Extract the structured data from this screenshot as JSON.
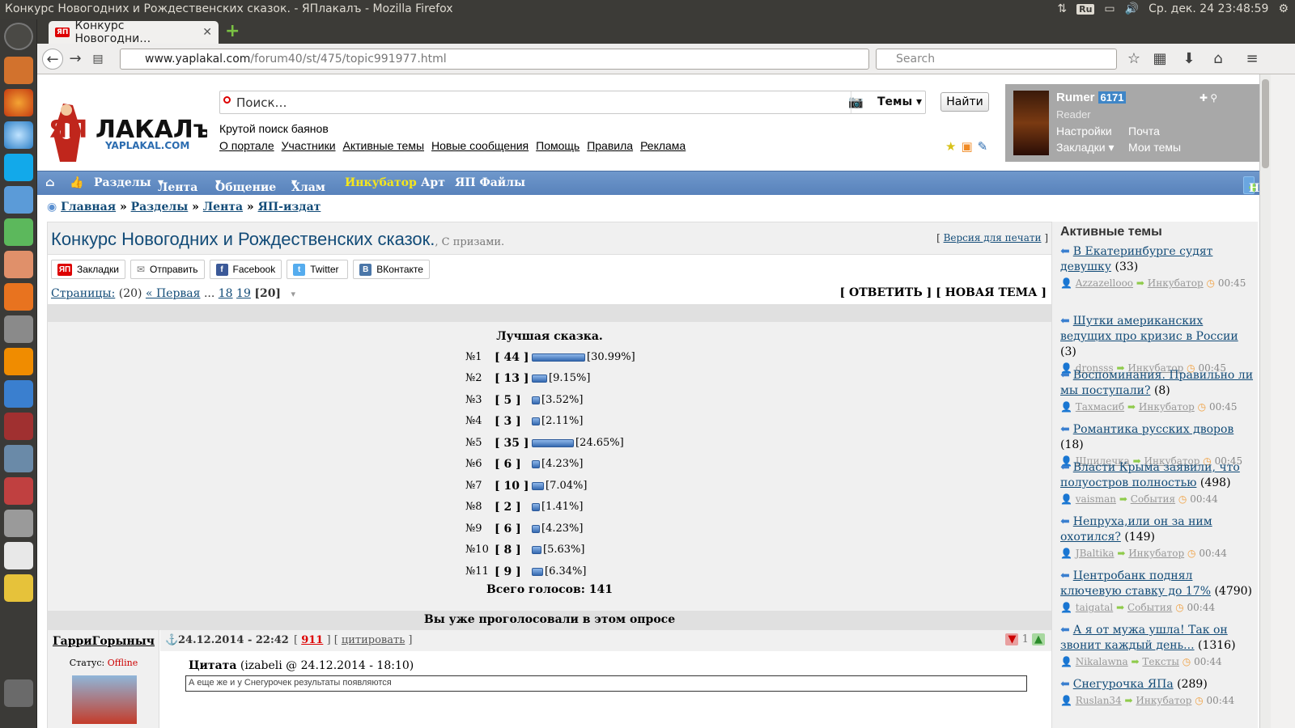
{
  "os": {
    "window_title": "Конкурс Новогодних и Рождественских сказок. - ЯПлакалъ - Mozilla Firefox",
    "lang": "Ru",
    "clock": "Ср. дек. 24 23:48:59"
  },
  "browser": {
    "tab_title": "Конкурс Новогодни…",
    "tab_favicon": "ЯП",
    "url_host": "www.yaplakal.com",
    "url_path": "/forum40/st/475/topic991977.html",
    "search_placeholder": "Search"
  },
  "site": {
    "search_placeholder": "Поиск…",
    "search_category": "Темы",
    "search_button": "Найти",
    "slogan": "Крутой поиск баянов",
    "top_links": [
      "О портале",
      "Участники",
      "Активные темы",
      "Новые сообщения",
      "Помощь",
      "Правила",
      "Реклама"
    ],
    "user": {
      "name": "Rumer",
      "rep": "6171",
      "role": "Reader",
      "links": [
        "Настройки",
        "Почта",
        "Закладки",
        "Мои темы"
      ]
    },
    "menu": [
      "Разделы",
      "Лента",
      "Общение",
      "Хлам",
      "Инкубатор",
      "Арт",
      "ЯП Файлы"
    ],
    "new_post": "Новый пост",
    "breadcrumb": [
      "Главная",
      "Разделы",
      "Лента",
      "ЯП-издат"
    ]
  },
  "topic": {
    "title": "Конкурс Новогодних и Рождественских сказок.",
    "subtitle": ", С призами.",
    "print_version": "Версия для печати",
    "share": [
      "Закладки",
      "Отправить",
      "Facebook",
      "Twitter",
      "ВКонтакте"
    ],
    "pages_label": "Страницы:",
    "pages_count": "(20)",
    "first": "« Первая",
    "ellipsis": "...",
    "page_links": [
      "18",
      "19"
    ],
    "current_page": "[20]",
    "reply": "[ ОТВЕТИТЬ ]",
    "new_topic": "[ НОВАЯ ТЕМА ]"
  },
  "poll": {
    "title": "Лучшая сказка.",
    "options": [
      {
        "label": "№1",
        "votes": "44",
        "percent": "[30.99%]",
        "value": 30.99
      },
      {
        "label": "№2",
        "votes": "13",
        "percent": "[9.15%]",
        "value": 9.15
      },
      {
        "label": "№3",
        "votes": "5",
        "percent": "[3.52%]",
        "value": 3.52
      },
      {
        "label": "№4",
        "votes": "3",
        "percent": "[2.11%]",
        "value": 2.11
      },
      {
        "label": "№5",
        "votes": "35",
        "percent": "[24.65%]",
        "value": 24.65
      },
      {
        "label": "№6",
        "votes": "6",
        "percent": "[4.23%]",
        "value": 4.23
      },
      {
        "label": "№7",
        "votes": "10",
        "percent": "[7.04%]",
        "value": 7.04
      },
      {
        "label": "№8",
        "votes": "2",
        "percent": "[1.41%]",
        "value": 1.41
      },
      {
        "label": "№9",
        "votes": "6",
        "percent": "[4.23%]",
        "value": 4.23
      },
      {
        "label": "№10",
        "votes": "8",
        "percent": "[5.63%]",
        "value": 5.63
      },
      {
        "label": "№11",
        "votes": "9",
        "percent": "[6.34%]",
        "value": 6.34
      }
    ],
    "total": "Всего голосов: 141",
    "voted_msg": "Вы уже проголосовали в этом опросе"
  },
  "post": {
    "author": "ГарриГорыныч",
    "status_label": "Статус:",
    "status_value": "Offline",
    "date": "24.12.2014 - 22:42",
    "post_num": "911",
    "quote_link": "цитировать",
    "rating": "1",
    "quote_header": "Цитата",
    "quote_source": "(izabeli @ 24.12.2014 - 18:10)",
    "quote_text": "А еще же и у Снегурочек результаты появляются"
  },
  "sidebar": {
    "title": "Активные темы",
    "items": [
      {
        "title": "В Екатеринбурге судят девушку",
        "count": "(33)",
        "author": "Azzazellooo",
        "section": "Инкубатор",
        "time": "00:45"
      },
      {
        "title": "Шутки американских ведущих про кризис в России",
        "count": "(3)",
        "author": "dronsss",
        "section": "Инкубатор",
        "time": "00:45"
      },
      {
        "title": "Воспоминания. Правильно ли мы поступали?",
        "count": "(8)",
        "author": "Тахмасиб",
        "section": "Инкубатор",
        "time": "00:45"
      },
      {
        "title": "Романтика русских дворов",
        "count": "(18)",
        "author": "Шпилечка",
        "section": "Инкубатор",
        "time": "00:45"
      },
      {
        "title": "Власти Крыма заявили, что полуостров полностью",
        "count": "(498)",
        "author": "vaisman",
        "section": "События",
        "time": "00:44"
      },
      {
        "title": "Непруха,или он за ним охотился?",
        "count": "(149)",
        "author": "JBaltika",
        "section": "Инкубатор",
        "time": "00:44"
      },
      {
        "title": "Центробанк поднял ключевую ставку до 17%",
        "count": "(4790)",
        "author": "taigatal",
        "section": "События",
        "time": "00:44"
      },
      {
        "title": "А я от мужа ушла! Так он звонит каждый день...",
        "count": "(1316)",
        "author": "Nikalawna",
        "section": "Тексты",
        "time": "00:44"
      },
      {
        "title": "Снегурочка ЯПа",
        "count": "(289)",
        "author": "Ruslan34",
        "section": "Инкубатор",
        "time": "00:44"
      }
    ]
  },
  "colors": {
    "link": "#134c78",
    "menu": "#5882bb",
    "incubator": "#f5e61c",
    "poll_bar": "#3569b0"
  }
}
